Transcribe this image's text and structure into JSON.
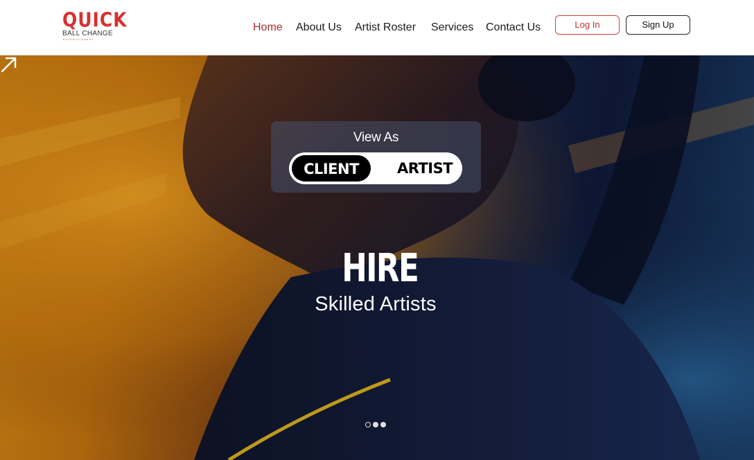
{
  "header": {
    "logo": {
      "top": "QUICK",
      "bottom": "BALL CHANGE",
      "tiny": "ENTERTAINMENT"
    },
    "nav": [
      {
        "label": "Home",
        "active": true
      },
      {
        "label": "About Us",
        "active": false
      },
      {
        "label": "Artist Roster",
        "active": false
      },
      {
        "label": "Services",
        "active": false
      },
      {
        "label": "Contact Us",
        "active": false
      }
    ],
    "login_label": "Log In",
    "signup_label": "Sign Up"
  },
  "hero": {
    "view_as": "View As",
    "toggle": {
      "options": [
        "CLIENT",
        "ARTIST"
      ],
      "selected": "CLIENT"
    },
    "headline": "HIRE",
    "subheadline": "Skilled Artists",
    "carousel": {
      "count": 3,
      "active_index": 0
    }
  },
  "colors": {
    "brand_red": "#d8302f",
    "nav_active": "#a8302c",
    "text_dark": "#1a1a1a"
  }
}
